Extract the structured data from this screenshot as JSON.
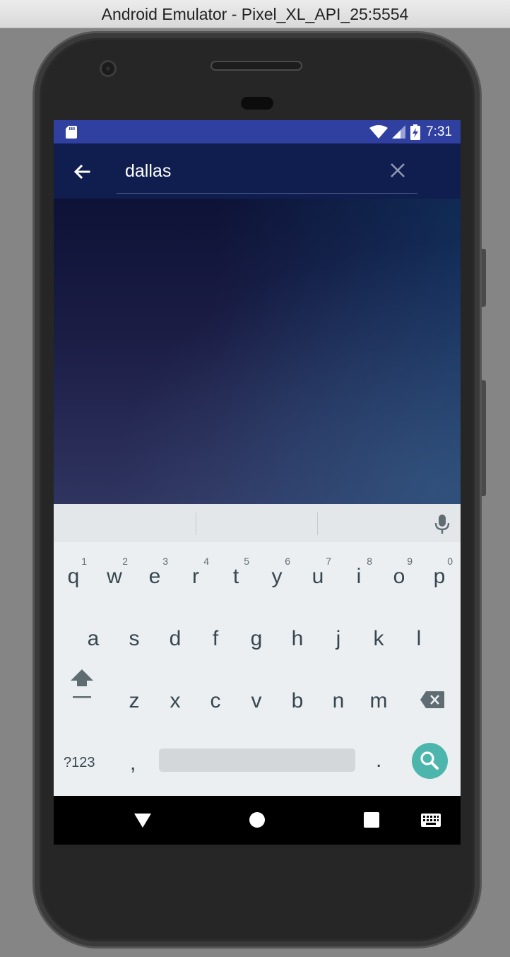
{
  "window": {
    "title": "Android Emulator - Pixel_XL_API_25:5554"
  },
  "status_bar": {
    "time": "7:31"
  },
  "search": {
    "query": "dallas"
  },
  "keyboard": {
    "row1": [
      {
        "ch": "q",
        "num": "1"
      },
      {
        "ch": "w",
        "num": "2"
      },
      {
        "ch": "e",
        "num": "3"
      },
      {
        "ch": "r",
        "num": "4"
      },
      {
        "ch": "t",
        "num": "5"
      },
      {
        "ch": "y",
        "num": "6"
      },
      {
        "ch": "u",
        "num": "7"
      },
      {
        "ch": "i",
        "num": "8"
      },
      {
        "ch": "o",
        "num": "9"
      },
      {
        "ch": "p",
        "num": "0"
      }
    ],
    "row2": [
      "a",
      "s",
      "d",
      "f",
      "g",
      "h",
      "j",
      "k",
      "l"
    ],
    "row3": [
      "z",
      "x",
      "c",
      "v",
      "b",
      "n",
      "m"
    ],
    "symbols_label": "?123",
    "comma_label": ",",
    "period_label": "."
  },
  "colors": {
    "status_bar": "#3040a0",
    "search_bar": "#0f1d4f",
    "search_key": "#4db6ac"
  },
  "icons": [
    "sd-card-icon",
    "wifi-icon",
    "signal-icon",
    "battery-charging-icon",
    "back-arrow-icon",
    "clear-icon",
    "mic-icon",
    "shift-icon",
    "backspace-icon",
    "search-icon",
    "nav-back-icon",
    "nav-home-icon",
    "nav-recents-icon",
    "keyboard-switch-icon"
  ]
}
